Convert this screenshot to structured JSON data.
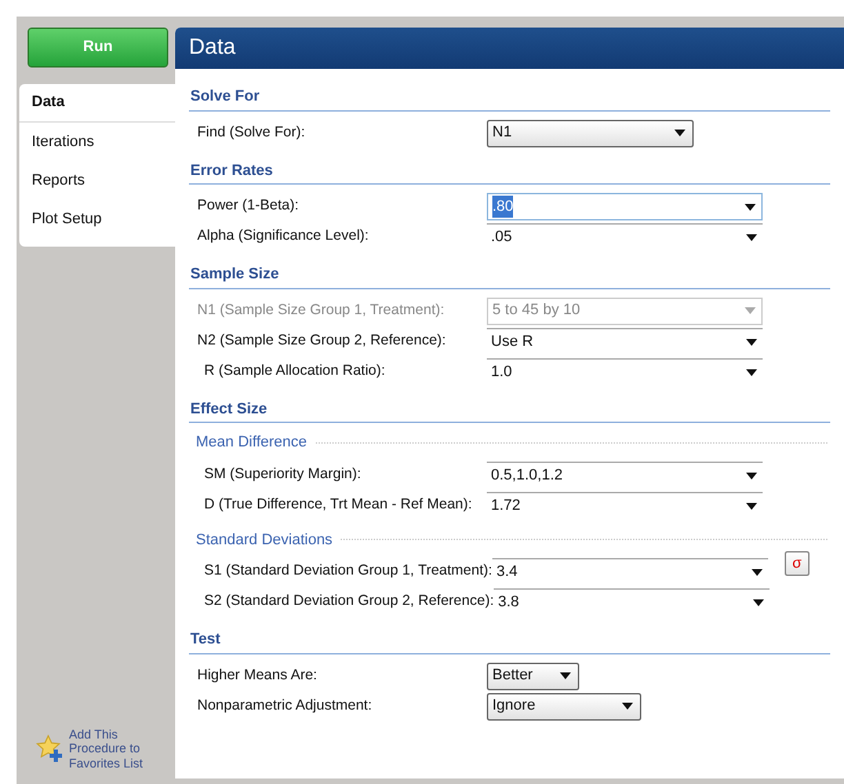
{
  "run_button": "Run",
  "tabs": [
    {
      "label": "Data",
      "selected": true
    },
    {
      "label": "Iterations",
      "selected": false
    },
    {
      "label": "Reports",
      "selected": false
    },
    {
      "label": "Plot Setup",
      "selected": false
    }
  ],
  "favorites_link": "Add This Procedure to Favorites List",
  "panel_title": "Data",
  "sections": [
    {
      "title": "Solve For",
      "groups": [
        {
          "rows": [
            {
              "label": "Find (Solve For):",
              "value": "N1",
              "kind": "dropdown",
              "disabled": false,
              "focused": false
            }
          ]
        }
      ]
    },
    {
      "title": "Error Rates",
      "groups": [
        {
          "rows": [
            {
              "label": "Power (1-Beta):",
              "value": ".80",
              "kind": "combo",
              "disabled": false,
              "focused": true
            },
            {
              "label": "Alpha (Significance Level):",
              "value": ".05",
              "kind": "combo",
              "disabled": false,
              "focused": false
            }
          ]
        }
      ]
    },
    {
      "title": "Sample Size",
      "groups": [
        {
          "rows": [
            {
              "label": "N1 (Sample Size Group 1, Treatment):",
              "value": "5 to 45 by 10",
              "kind": "combo",
              "disabled": true,
              "focused": false
            },
            {
              "label": "N2 (Sample Size Group 2, Reference):",
              "value": "Use R",
              "kind": "combo",
              "disabled": false,
              "focused": false,
              "children": [
                {
                  "label": "R (Sample Allocation Ratio):",
                  "value": "1.0",
                  "kind": "combo",
                  "disabled": false,
                  "focused": false
                }
              ]
            }
          ]
        }
      ]
    },
    {
      "title": "Effect Size",
      "groups": [
        {
          "title": "Mean Difference",
          "rows": [
            {
              "label": "SM (Superiority Margin):",
              "value": "0.5,1.0,1.2",
              "kind": "combo",
              "disabled": false,
              "focused": false
            },
            {
              "label": "D (True Difference, Trt Mean - Ref Mean):",
              "value": "1.72",
              "kind": "combo",
              "disabled": false,
              "focused": false
            }
          ]
        },
        {
          "title": "Standard Deviations",
          "side_button": "σ",
          "rows": [
            {
              "label": "S1 (Standard Deviation Group 1, Treatment):",
              "value": "3.4",
              "kind": "combo",
              "disabled": false,
              "focused": false
            },
            {
              "label": "S2 (Standard Deviation Group 2, Reference):",
              "value": "3.8",
              "kind": "combo",
              "disabled": false,
              "focused": false
            }
          ]
        }
      ]
    },
    {
      "title": "Test",
      "groups": [
        {
          "rows": [
            {
              "label": "Higher Means Are:",
              "value": "Better",
              "kind": "dropdown",
              "disabled": false,
              "focused": false
            },
            {
              "label": "Nonparametric Adjustment:",
              "value": "Ignore",
              "kind": "dropdown",
              "disabled": false,
              "focused": false
            }
          ]
        }
      ]
    }
  ]
}
